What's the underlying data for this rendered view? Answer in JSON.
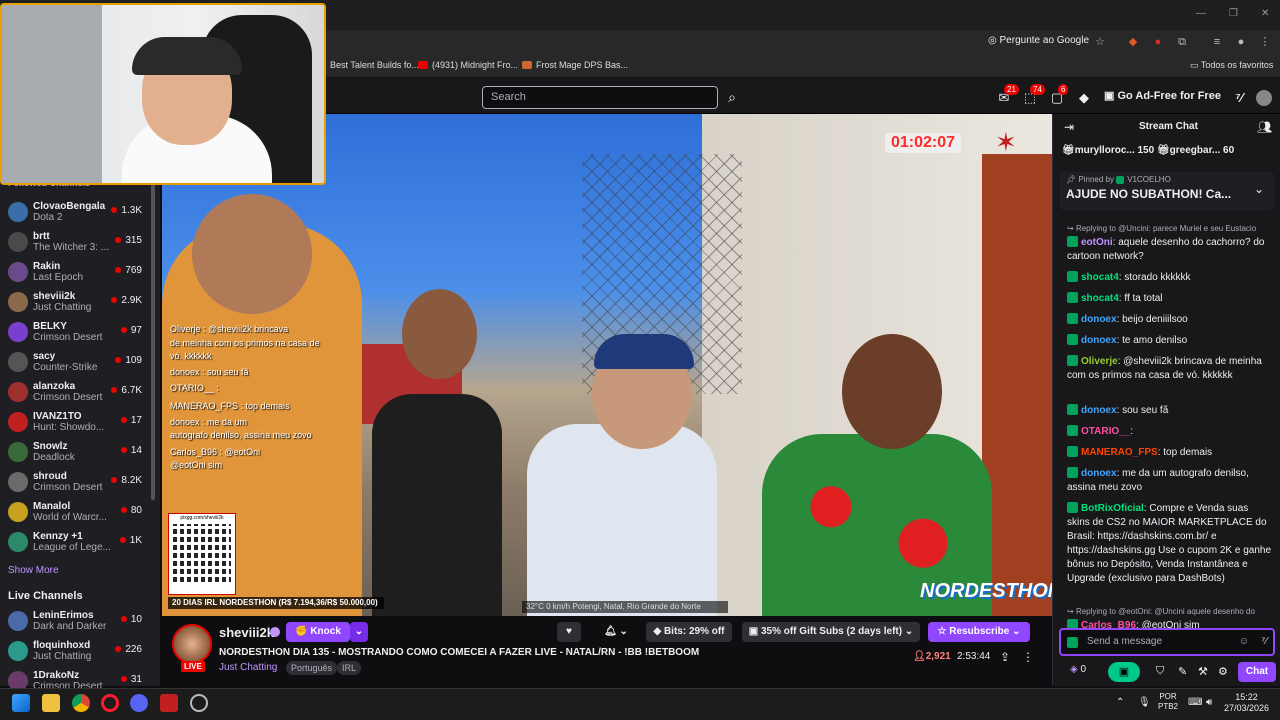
{
  "browser": {
    "ask_google": "Pergunte ao Google",
    "bookmarks": [
      "Best Talent Builds fo...",
      "(4931) Midnight Fro...",
      "Frost Mage DPS Bas..."
    ],
    "all_bookmarks": "Todos os favoritos"
  },
  "nav": {
    "search_placeholder": "Search",
    "badges": [
      "21",
      "74",
      "6"
    ],
    "ad_free": "Go Ad-Free for Free"
  },
  "sidebar": {
    "followed_header": "Followed Channels",
    "followed": [
      {
        "name": "ClovaoBengala",
        "game": "Dota 2",
        "viewers": "1.3K",
        "color": "#3b6ea8"
      },
      {
        "name": "brtt",
        "game": "The Witcher 3: ...",
        "viewers": "315",
        "color": "#4a4a4a"
      },
      {
        "name": "Rakin",
        "game": "Last Epoch",
        "viewers": "769",
        "color": "#6a4a8a"
      },
      {
        "name": "sheviii2k",
        "game": "Just Chatting",
        "viewers": "2.9K",
        "color": "#8a6a4a"
      },
      {
        "name": "BELKY",
        "game": "Crimson Desert",
        "viewers": "97",
        "color": "#7b3fcf"
      },
      {
        "name": "sacy",
        "game": "Counter-Strike",
        "viewers": "109",
        "color": "#555"
      },
      {
        "name": "alanzoka",
        "game": "Crimson Desert",
        "viewers": "6.7K",
        "color": "#a03030"
      },
      {
        "name": "IVANZ1TO",
        "game": "Hunt: Showdo...",
        "viewers": "17",
        "color": "#c02020"
      },
      {
        "name": "Snowlz",
        "game": "Deadlock",
        "viewers": "14",
        "color": "#3a6a3a"
      },
      {
        "name": "shroud",
        "game": "Crimson Desert",
        "viewers": "8.2K",
        "color": "#6a6a6a"
      },
      {
        "name": "Manalol",
        "game": "World of Warcr...",
        "viewers": "80",
        "color": "#c8a020"
      },
      {
        "name": "Kennzy +1",
        "game": "League of Lege...",
        "viewers": "1K",
        "color": "#2a8a6a"
      }
    ],
    "show_more": "Show More",
    "live_header": "Live Channels",
    "live": [
      {
        "name": "LeninErimos",
        "game": "Dark and Darker",
        "viewers": "10",
        "color": "#4a6aa8"
      },
      {
        "name": "floquinhoxd",
        "game": "Just Chatting",
        "viewers": "226",
        "color": "#2a9a8a"
      },
      {
        "name": "1DrakoNz",
        "game": "Crimson Desert",
        "viewers": "31",
        "color": "#6a3a6a"
      }
    ]
  },
  "video": {
    "timer": "01:02:07",
    "goal": "20 DIAS IRL NORDESTHON (R$ 7.194,36/R$ 50.000,00)",
    "telemetry": "32°C     0 km/h     Potengi, Natal, Rio Grande do Norte",
    "logo": "NORDESTHON",
    "qr_label": "pixgg.com/sheviii2k",
    "overlay_chat": [
      "Oliverje : @sheviii2k brincava",
      "de meinha com os primos na casa de",
      "vó. kkkkkk",
      "donoex : sou seu fã",
      "OTARIO__ :",
      "MANERAO_FPS : top demais",
      "donoex : me da um",
      "autografo denilso, assina meu zovo",
      "Carlos_B96 : @eotOni",
      "@eotOni sim"
    ]
  },
  "stream": {
    "name": "sheviii2k",
    "live": "LIVE",
    "knock": "Knock",
    "bits": "Bits: 29% off",
    "gift": "35% off Gift Subs (2 days left)",
    "resub": "Resubscribe",
    "title": "NORDESTHON DIA 135 - MOSTRANDO COMO COMECEI A FAZER LIVE - NATAL/RN - !BB !BETBOOM",
    "category": "Just Chatting",
    "tags": [
      "Português",
      "IRL"
    ],
    "viewers": "2,921",
    "uptime": "2:53:44"
  },
  "chat": {
    "title": "Stream Chat",
    "top_gifters": [
      {
        "name": "murylloroc...",
        "count": "150"
      },
      {
        "name": "greegbar...",
        "count": "60"
      }
    ],
    "pinned_by": "Pinned by",
    "pinned_user": "V1COELHO",
    "pinned_text": "AJUDE NO SUBATHON! Ca...",
    "messages": [
      {
        "reply": "Replying to @Uncini: parece Muriel e seu Eustacio",
        "user": "eotOni",
        "color": "#bf94ff",
        "text": "aquele desenho do cachorro? do cartoon network?"
      },
      {
        "user": "shocat4",
        "color": "#00e07a",
        "text": "storado kkkkkk"
      },
      {
        "user": "shocat4",
        "color": "#00e07a",
        "text": "ff ta total"
      },
      {
        "user": "donoex",
        "color": "#3fa7ff",
        "text": "beijo deniiilsoo"
      },
      {
        "user": "donoex",
        "color": "#3fa7ff",
        "text": "te amo denilso"
      },
      {
        "user": "Oliverje",
        "color": "#9acd32",
        "text": "@sheviii2k brincava de meinha com os primos na casa de vó. kkkkkk"
      },
      {
        "user": "donoex",
        "color": "#3fa7ff",
        "text": "sou seu fã"
      },
      {
        "user": "OTARIO__",
        "color": "#ff4fa0",
        "text": ""
      },
      {
        "user": "MANERAO_FPS",
        "color": "#ff4500",
        "text": "top demais"
      },
      {
        "user": "donoex",
        "color": "#3fa7ff",
        "text": "me da um autografo denilso, assina meu zovo"
      },
      {
        "user": "BotRixOficial",
        "color": "#00e07a",
        "text": "Compre e Venda suas skins de CS2 no MAIOR MARKETPLACE do Brasil: https://dashskins.com.br/ e https://dashskins.gg Use o cupom 2K e ganhe bônus no Depósito, Venda Instantânea e Upgrade (exclusivo para DashBots)"
      },
      {
        "reply": "Replying to @eotOni: @Uncini aquele desenho do",
        "user": "Carlos_B96",
        "color": "#ff4fa0",
        "text": "@eotOni sim"
      }
    ],
    "input_placeholder": "Send a message",
    "points": "0",
    "chat_button": "Chat"
  },
  "taskbar": {
    "lang": "POR",
    "lang2": "PTB2",
    "time": "15:22",
    "date": "27/03/2026"
  }
}
